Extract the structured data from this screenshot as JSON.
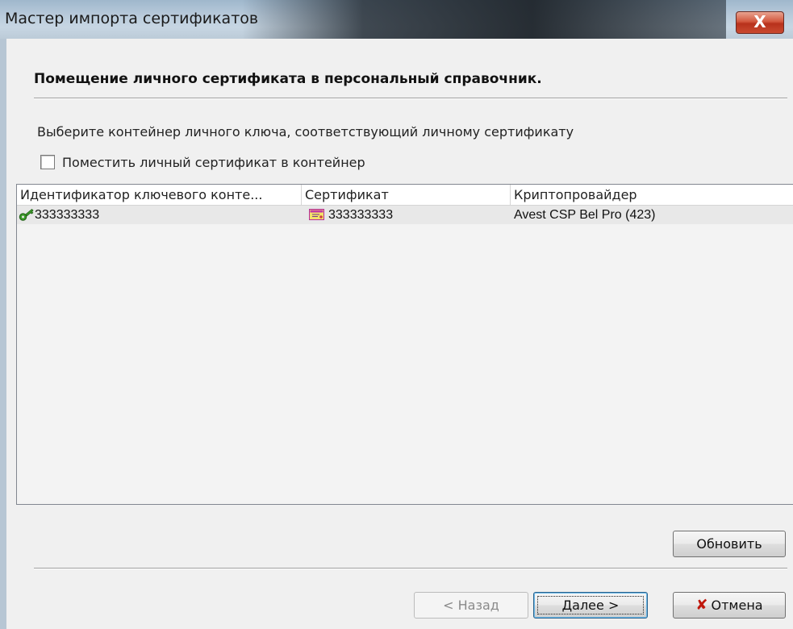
{
  "window": {
    "title": "Мастер импорта сертификатов",
    "close_glyph": "X"
  },
  "page": {
    "heading": "Помещение личного сертификата в персональный справочник.",
    "instruction": "Выберите контейнер личного ключа, соответствующий личному сертификату",
    "checkbox": {
      "label": "Поместить личный сертификат в контейнер",
      "checked": false
    }
  },
  "table": {
    "columns": [
      "Идентификатор ключевого конте...",
      "Сертификат",
      "Криптопровайдер"
    ],
    "rows": [
      {
        "container_id": "333333333",
        "container_icon": "key-icon",
        "certificate": "333333333",
        "certificate_icon": "certificate-icon",
        "provider": "Avest CSP Bel Pro (423)"
      }
    ]
  },
  "buttons": {
    "refresh": "Обновить",
    "back": "< Назад",
    "next": "Далее >",
    "cancel": "Отмена",
    "cancel_icon": "x-icon"
  },
  "colors": {
    "cancel_icon": "#c0180c",
    "close_button": "#c94a30",
    "key_icon": "#3c9a2a"
  }
}
